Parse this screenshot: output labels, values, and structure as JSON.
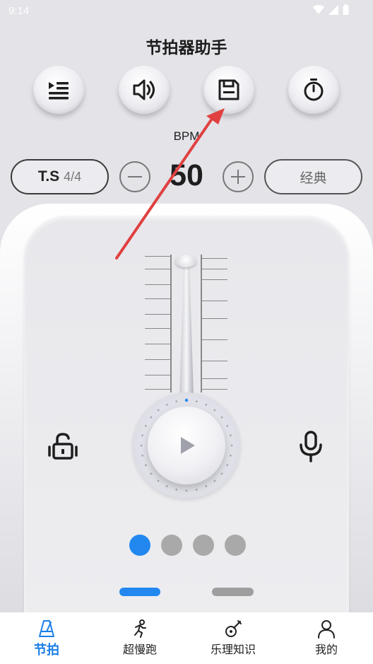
{
  "status_bar": {
    "time": "9:14",
    "icons": [
      "wifi-icon",
      "signal-icon",
      "battery-icon"
    ]
  },
  "app": {
    "title": "节拍器助手"
  },
  "toolbar": {
    "buttons": [
      {
        "icon": "playlist-icon"
      },
      {
        "icon": "sound-icon"
      },
      {
        "icon": "save-icon"
      },
      {
        "icon": "timer-icon"
      }
    ]
  },
  "tempo": {
    "bpm_label": "BPM",
    "bpm_value": "50",
    "time_signature_label": "T.S",
    "time_signature_value": "4/4",
    "mode": "经典"
  },
  "pager": {
    "dot_count": 4,
    "active_index": 0
  },
  "bottom_nav": {
    "items": [
      {
        "label": "节拍",
        "icon": "metronome-icon",
        "active": true
      },
      {
        "label": "超慢跑",
        "icon": "runner-icon",
        "active": false
      },
      {
        "label": "乐理知识",
        "icon": "guitar-icon",
        "active": false
      },
      {
        "label": "我的",
        "icon": "person-icon",
        "active": false
      }
    ]
  },
  "colors": {
    "accent": "#2288f0",
    "annotation_arrow": "#e04040",
    "background": "#e3e3e8"
  }
}
